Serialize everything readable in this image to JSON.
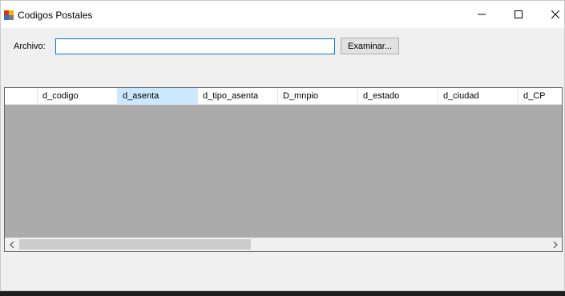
{
  "window": {
    "title": "Codigos Postales"
  },
  "form": {
    "archivo_label": "Archivo:",
    "archivo_value": "",
    "browse_label": "Examinar..."
  },
  "grid": {
    "columns": [
      "d_codigo",
      "d_asenta",
      "d_tipo_asenta",
      "D_mnpio",
      "d_estado",
      "d_ciudad",
      "d_CP"
    ],
    "selected_column": "d_asenta"
  },
  "icons": {
    "app": "app-icon",
    "minimize": "minimize-icon",
    "maximize": "maximize-icon",
    "close": "close-icon",
    "scroll_left": "chevron-left-icon",
    "scroll_right": "chevron-right-icon"
  },
  "colors": {
    "selected_header": "#cce8ff",
    "grid_background": "#ababab",
    "input_focus_border": "#0078d7"
  }
}
